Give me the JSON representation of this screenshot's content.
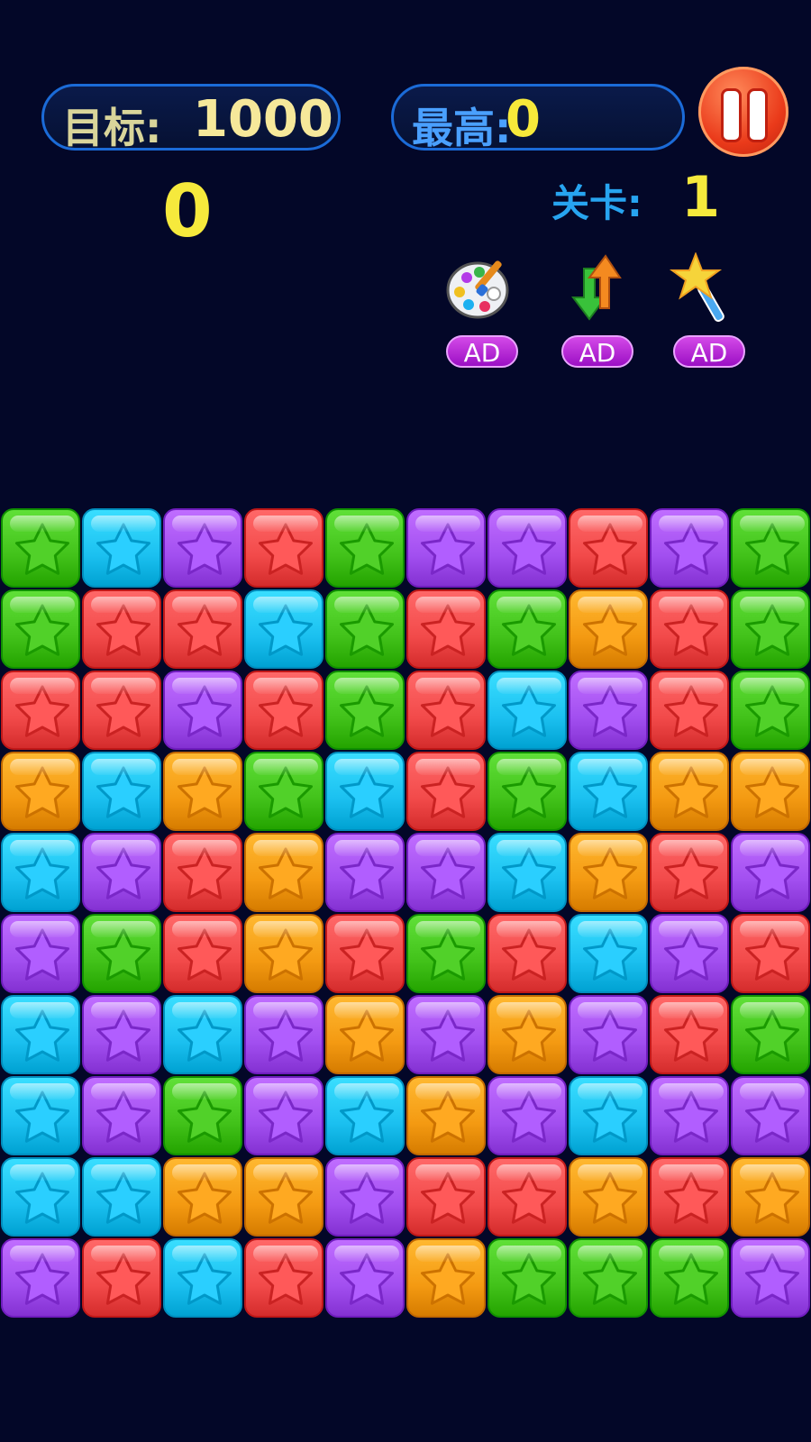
{
  "header": {
    "target_label": "目标:",
    "target_value": "1000",
    "best_label": "最高:",
    "best_value": "0",
    "pause_icon": "pause-icon",
    "current_score": "0",
    "level_label": "关卡:",
    "level_value": "1"
  },
  "tools": [
    {
      "icon": "paint-palette-icon",
      "ad_label": "AD"
    },
    {
      "icon": "swap-arrows-icon",
      "ad_label": "AD"
    },
    {
      "icon": "star-wand-icon",
      "ad_label": "AD"
    }
  ],
  "colors": {
    "green": "#42c21a",
    "blue": "#1bc0f0",
    "purple": "#a24ff0",
    "red": "#f24a4a",
    "orange": "#f49a12"
  },
  "board": {
    "rows": 10,
    "cols": 10,
    "grid": [
      [
        "green",
        "blue",
        "purple",
        "red",
        "green",
        "purple",
        "purple",
        "red",
        "purple",
        "green"
      ],
      [
        "green",
        "red",
        "red",
        "blue",
        "green",
        "red",
        "green",
        "orange",
        "red",
        "green"
      ],
      [
        "red",
        "red",
        "purple",
        "red",
        "green",
        "red",
        "blue",
        "purple",
        "red",
        "green"
      ],
      [
        "orange",
        "blue",
        "orange",
        "green",
        "blue",
        "red",
        "green",
        "blue",
        "orange",
        "orange"
      ],
      [
        "blue",
        "purple",
        "red",
        "orange",
        "purple",
        "purple",
        "blue",
        "orange",
        "red",
        "purple"
      ],
      [
        "purple",
        "green",
        "red",
        "orange",
        "red",
        "green",
        "red",
        "blue",
        "purple",
        "red"
      ],
      [
        "blue",
        "purple",
        "blue",
        "purple",
        "orange",
        "purple",
        "orange",
        "purple",
        "red",
        "green"
      ],
      [
        "blue",
        "purple",
        "green",
        "purple",
        "blue",
        "orange",
        "purple",
        "blue",
        "purple",
        "purple"
      ],
      [
        "blue",
        "blue",
        "orange",
        "orange",
        "purple",
        "red",
        "red",
        "orange",
        "red",
        "orange"
      ],
      [
        "purple",
        "red",
        "blue",
        "red",
        "purple",
        "orange",
        "green",
        "green",
        "green",
        "purple"
      ]
    ]
  }
}
